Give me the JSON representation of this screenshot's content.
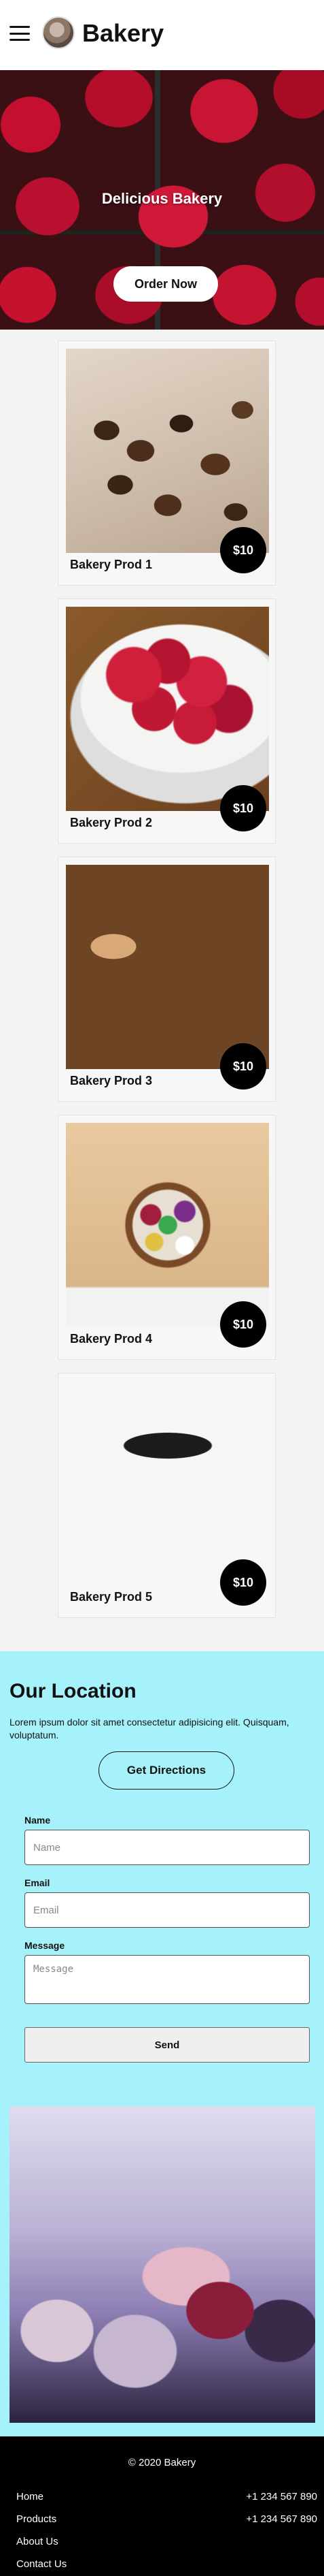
{
  "header": {
    "brand": "Bakery"
  },
  "hero": {
    "title": "Delicious Bakery",
    "button": "Order Now"
  },
  "products": [
    {
      "name": "Bakery Prod 1",
      "price": "$10"
    },
    {
      "name": "Bakery Prod 2",
      "price": "$10"
    },
    {
      "name": "Bakery Prod 3",
      "price": "$10"
    },
    {
      "name": "Bakery Prod 4",
      "price": "$10"
    },
    {
      "name": "Bakery Prod 5",
      "price": "$10"
    }
  ],
  "location": {
    "title": "Our Location",
    "text": "Lorem ipsum dolor sit amet consectetur adipisicing elit. Quisquam, voluptatum.",
    "button": "Get Directions"
  },
  "form": {
    "name_label": "Name",
    "name_placeholder": "Name",
    "email_label": "Email",
    "email_placeholder": "Email",
    "message_label": "Message",
    "message_placeholder": "Message",
    "send": "Send"
  },
  "footer": {
    "copyright": "© 2020 Bakery",
    "links": [
      "Home",
      "Products",
      "About Us",
      "Contact Us"
    ],
    "phones": [
      "+1 234 567 890",
      "+1 234 567 890"
    ]
  },
  "colors": {
    "location_bg": "#a6f2fb",
    "price_badge": "#000000",
    "footer_bg": "#000000"
  }
}
